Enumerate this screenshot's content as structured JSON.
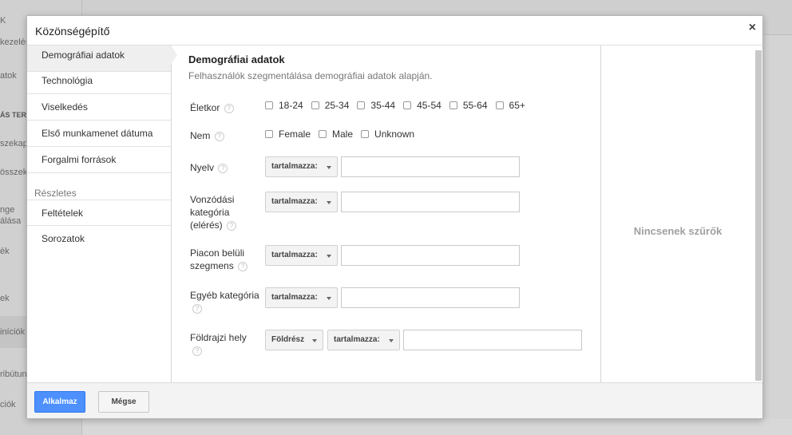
{
  "background": {
    "sidebar_items": [
      {
        "label": "K",
        "bold": false
      },
      {
        "label": "kezelés",
        "bold": false
      },
      {
        "label": "atok",
        "bold": false
      },
      {
        "label": "ÁS TER",
        "bold": true
      },
      {
        "label": "szekap",
        "bold": false
      },
      {
        "label": "összek",
        "bold": false
      },
      {
        "label": "nge",
        "bold": false
      },
      {
        "label": "álása",
        "bold": false
      },
      {
        "label": "ék",
        "bold": false
      },
      {
        "label": "ek",
        "bold": false
      },
      {
        "label": "iníciók",
        "bold": false
      },
      {
        "label": "ribútun",
        "bold": false
      },
      {
        "label": "ciók",
        "bold": false
      }
    ]
  },
  "modal": {
    "title": "Közönségépítő",
    "close_label": "×",
    "nav": {
      "items": [
        {
          "label": "Demográfiai adatok",
          "active": true
        },
        {
          "label": "Technológia",
          "active": false
        },
        {
          "label": "Viselkedés",
          "active": false
        },
        {
          "label": "Első munkamenet dátuma",
          "active": false
        },
        {
          "label": "Forgalmi források",
          "active": false
        }
      ],
      "section_label": "Részletes",
      "section_items": [
        {
          "label": "Feltételek"
        },
        {
          "label": "Sorozatok"
        }
      ]
    },
    "content": {
      "title": "Demográfiai adatok",
      "description": "Felhasználók szegmentálása demográfiai adatok alapján.",
      "help_glyph": "?",
      "age": {
        "label": "Életkor",
        "options": [
          "18-24",
          "25-34",
          "35-44",
          "45-54",
          "55-64",
          "65+"
        ]
      },
      "gender": {
        "label": "Nem",
        "options": [
          "Female",
          "Male",
          "Unknown"
        ]
      },
      "language": {
        "label": "Nyelv",
        "operator": "tartalmazza:",
        "value": ""
      },
      "affinity": {
        "label_lines": [
          "Vonzódási",
          "kategória",
          "(elérés)"
        ],
        "operator": "tartalmazza:",
        "value": ""
      },
      "in_market": {
        "label_lines": [
          "Piacon belüli",
          "szegmens"
        ],
        "operator": "tartalmazza:",
        "value": ""
      },
      "other_category": {
        "label": "Egyéb kategória",
        "operator": "tartalmazza:",
        "value": ""
      },
      "location": {
        "label": "Földrajzi hely",
        "scope": "Földrész",
        "operator": "tartalmazza:",
        "value": ""
      }
    },
    "summary": {
      "empty_label": "Nincsenek szűrők"
    },
    "footer": {
      "apply_label": "Alkalmaz",
      "cancel_label": "Mégse"
    }
  }
}
